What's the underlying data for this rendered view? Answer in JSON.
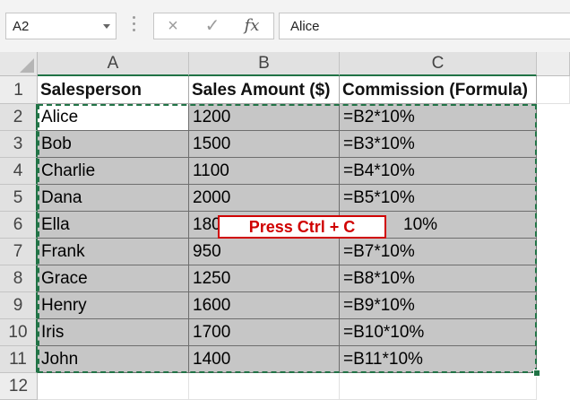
{
  "formula_bar": {
    "name_box": "A2",
    "cancel_icon": "×",
    "enter_icon": "✓",
    "fx_icon": "fx",
    "content": "Alice"
  },
  "columns": [
    "A",
    "B",
    "C"
  ],
  "rows": [
    "1",
    "2",
    "3",
    "4",
    "5",
    "6",
    "7",
    "8",
    "9",
    "10",
    "11",
    "12"
  ],
  "table": {
    "headers": [
      "Salesperson",
      "Sales Amount ($)",
      "Commission (Formula)"
    ],
    "rows": [
      [
        "Alice",
        "1200",
        "=B2*10%"
      ],
      [
        "Bob",
        "1500",
        "=B3*10%"
      ],
      [
        "Charlie",
        "1100",
        "=B4*10%"
      ],
      [
        "Dana",
        "2000",
        "=B5*10%"
      ],
      [
        "Ella",
        "180",
        "10%"
      ],
      [
        "Frank",
        "950",
        "=B7*10%"
      ],
      [
        "Grace",
        "1250",
        "=B8*10%"
      ],
      [
        "Henry",
        "1600",
        "=B9*10%"
      ],
      [
        "Iris",
        "1700",
        "=B10*10%"
      ],
      [
        "John",
        "1400",
        "=B11*10%"
      ]
    ]
  },
  "callout": "Press Ctrl + C",
  "colors": {
    "selection_fill": "#c6c6c6",
    "accent_green": "#217346",
    "callout_red": "#d00000"
  }
}
